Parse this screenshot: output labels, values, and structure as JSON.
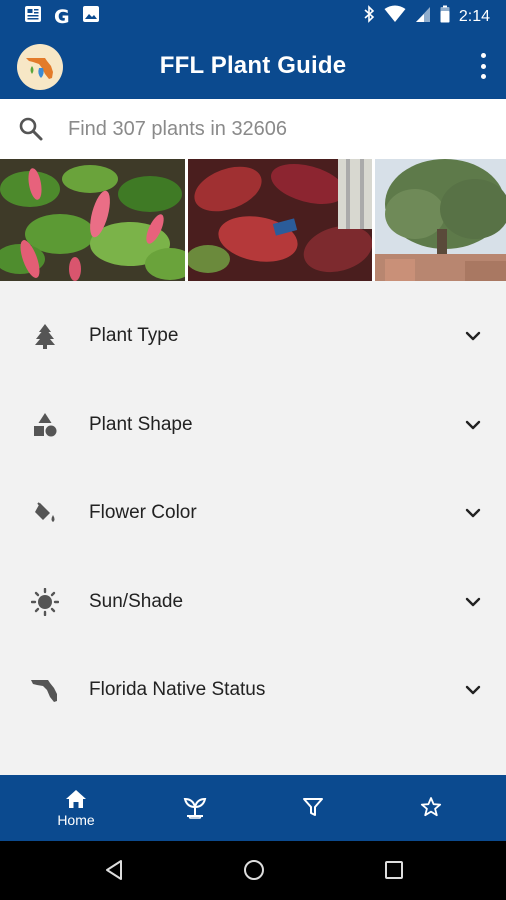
{
  "status_bar": {
    "time": "2:14",
    "left_icons": [
      "news-icon",
      "google-icon",
      "image-icon"
    ],
    "right_icons": [
      "bluetooth-icon",
      "wifi-icon",
      "signal-icon",
      "battery-icon"
    ],
    "google_glyph": "G"
  },
  "app_bar": {
    "title": "FFL Plant Guide",
    "logo": "florida-logo-icon",
    "overflow_icon": "more-vert-icon"
  },
  "search": {
    "placeholder": "Find 307 plants in 32606",
    "value": "",
    "icon": "search-icon"
  },
  "photos": [
    {
      "subject": "red chenille plant"
    },
    {
      "subject": "red copperleaf plant"
    },
    {
      "subject": "oak tree landscape"
    }
  ],
  "filters": [
    {
      "label": "Plant Type",
      "icon": "tree-icon"
    },
    {
      "label": "Plant Shape",
      "icon": "shapes-icon"
    },
    {
      "label": "Flower Color",
      "icon": "paint-bucket-icon"
    },
    {
      "label": "Sun/Shade",
      "icon": "sun-icon"
    },
    {
      "label": "Florida Native Status",
      "icon": "florida-icon"
    }
  ],
  "bottom_nav": [
    {
      "label": "Home",
      "icon": "home-icon",
      "active": true
    },
    {
      "label": "",
      "icon": "sprout-icon",
      "active": false
    },
    {
      "label": "",
      "icon": "filter-icon",
      "active": false
    },
    {
      "label": "",
      "icon": "star-icon",
      "active": false
    }
  ],
  "system_nav": [
    "back-icon",
    "home-circle-icon",
    "recents-icon"
  ],
  "colors": {
    "primary": "#0b4a8f",
    "background": "#f2f2f2",
    "surface": "#ffffff",
    "text": "#222222"
  }
}
